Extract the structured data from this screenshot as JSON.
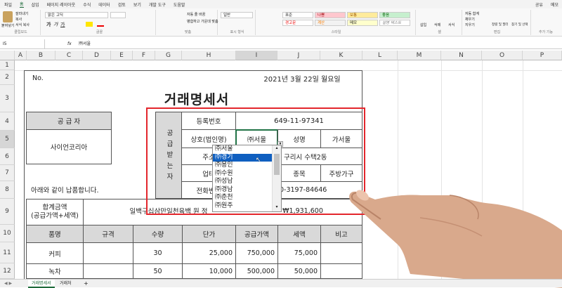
{
  "menu": {
    "tabs": [
      "파일",
      "홈",
      "삽입",
      "페이지 레이아웃",
      "수식",
      "데이터",
      "검토",
      "보기",
      "개발 도구",
      "도움말"
    ],
    "right": [
      "공유",
      "메모"
    ]
  },
  "ribbon": {
    "groups": [
      "클립보드",
      "글꼴",
      "맞춤",
      "표시 형식",
      "스타일",
      "셀",
      "편집",
      "추가 기능"
    ],
    "font_name": "맑은 고딕",
    "number_format": "일반",
    "styles": [
      "표준",
      "나쁨",
      "보통",
      "좋음",
      "경고문",
      "계산",
      "메모",
      "설명 텍스트"
    ],
    "clipboard": [
      "붙여넣기",
      "잘라내기",
      "복사",
      "서식 복사"
    ],
    "align": [
      "자동 줄 바꿈",
      "병합하고 가운데 맞춤"
    ],
    "cells": [
      "삽입",
      "삭제",
      "서식"
    ],
    "edit": [
      "자동 합계",
      "채우기",
      "지우기",
      "정렬 및 필터",
      "찾기 및 선택"
    ]
  },
  "formula_bar": {
    "name_box": "I5",
    "fx": "fx",
    "value": "㈜서울"
  },
  "columns": [
    "A",
    "B",
    "C",
    "D",
    "E",
    "F",
    "G",
    "H",
    "I",
    "J",
    "K",
    "L",
    "M",
    "N",
    "O",
    "P"
  ],
  "rows": [
    "1",
    "2",
    "3",
    "4",
    "5",
    "6",
    "7",
    "8",
    "9",
    "10",
    "11",
    "12"
  ],
  "invoice": {
    "no_label": "No.",
    "date": "2021년 3월 22일 월요일",
    "title": "거래명세서",
    "supplier_label": "공 급 자",
    "supplier_name": "사이언코리아",
    "receiver_label": "공급받는자",
    "reg_label": "등록번호",
    "reg_value": "649-11-97341",
    "company_label": "상호(법인명)",
    "company_value": "㈜서울",
    "name_label": "성명",
    "name_value": "가서울",
    "address_label": "주소",
    "address_value": "구리시 수택2동",
    "business_label": "업태",
    "item_label": "종목",
    "item_value": "주방가구",
    "phone_label": "전화번호",
    "phone_value": "0-3197-84646",
    "notice": "아래와 같이 납품합니다.",
    "total_label_1": "합계금액",
    "total_label_2": "(공급가액+세액)",
    "total_text": "일백구십삼만일천육백 원 정",
    "total_value": "₩1,931,600",
    "headers": [
      "품명",
      "규격",
      "수량",
      "단가",
      "공급가액",
      "세액",
      "비고"
    ],
    "items": [
      {
        "name": "커피",
        "spec": "",
        "qty": "30",
        "price": "25,000",
        "supply": "750,000",
        "tax": "75,000",
        "note": ""
      },
      {
        "name": "녹차",
        "spec": "",
        "qty": "50",
        "price": "10,000",
        "supply": "500,000",
        "tax": "50,000",
        "note": ""
      }
    ]
  },
  "dropdown": {
    "options": [
      "㈜서울",
      "㈜경기",
      "㈜용인",
      "㈜수원",
      "㈜성남",
      "㈜경남",
      "㈜춘천",
      "㈜원주"
    ],
    "selected_index": 1
  },
  "sheets": {
    "tabs": [
      "거래명세서",
      "거래처"
    ],
    "add": "+"
  }
}
